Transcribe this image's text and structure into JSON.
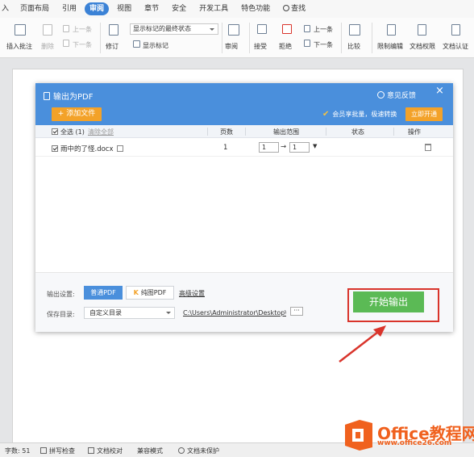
{
  "ribbon_tabs": [
    "入",
    "页面布局",
    "引用",
    "审阅",
    "视图",
    "章节",
    "安全",
    "开发工具",
    "特色功能",
    "查找"
  ],
  "active_tab": "审阅",
  "ribbon": {
    "insert_comment": "插入批注",
    "delete": "删除",
    "prev": "上一条",
    "next": "下一条",
    "track": "修订",
    "markup_state": "显示标记的最终状态",
    "show_markup": "显示标记",
    "review": "审阅",
    "accept": "接受",
    "reject": "拒绝",
    "prev2": "上一条",
    "next2": "下一条",
    "compare": "比较",
    "restrict": "限制编辑",
    "doc_rights": "文档权限",
    "doc_cert": "文档认证"
  },
  "dialog": {
    "title": "输出为PDF",
    "feedback": "意见反馈",
    "add_file": "+ 添加文件",
    "vip_text": "会员享批量，极速转换",
    "open_now": "立即开通",
    "columns": {
      "select_all": "全选 (1)",
      "clear_all": "清除全部",
      "pages": "页数",
      "range": "输出范围",
      "status": "状态",
      "actions": "操作"
    },
    "files": [
      {
        "name": "雨中的了怪.docx",
        "pages": "1",
        "from": "1",
        "to": "1",
        "checked": true
      }
    ],
    "output_settings_label": "输出设置:",
    "normal_pdf": "普通PDF",
    "image_pdf": "纯图PDF",
    "advanced": "高级设置",
    "save_dir_label": "保存目录:",
    "save_dir_option": "自定义目录",
    "save_path": "C:\\Users\\Administrator\\Desktop\\",
    "more": "···",
    "start_button": "开始输出"
  },
  "status_bar": {
    "word_count": "字数: 51",
    "spell_check": "拼写检查",
    "proofread": "文档校对",
    "compat_mode": "兼容模式",
    "unprotected": "文档未保护"
  },
  "watermark": {
    "brand": "Office教程网",
    "url": "www.office26.com"
  },
  "colors": {
    "accent_blue": "#4a8fdc",
    "orange": "#f3a229",
    "green": "#5bba55",
    "highlight_red": "#d9342b"
  }
}
